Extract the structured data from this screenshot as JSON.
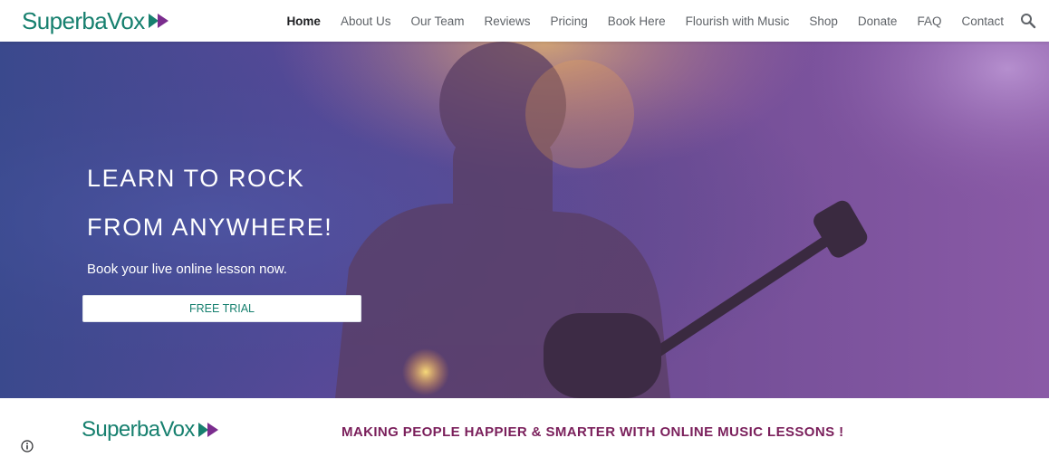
{
  "brand": {
    "name": "SuperbaVox",
    "primary_color": "#17806f",
    "accent_color": "#7b2d8e"
  },
  "nav": {
    "items": [
      {
        "label": "Home",
        "active": true
      },
      {
        "label": "About Us"
      },
      {
        "label": "Our Team"
      },
      {
        "label": "Reviews"
      },
      {
        "label": "Pricing"
      },
      {
        "label": "Book Here"
      },
      {
        "label": "Flourish with Music"
      },
      {
        "label": "Shop"
      },
      {
        "label": "Donate"
      },
      {
        "label": "FAQ"
      },
      {
        "label": "Contact"
      }
    ],
    "search_icon": "search-icon"
  },
  "hero": {
    "title_line1": "LEARN TO ROCK",
    "title_line2": "FROM ANYWHERE!",
    "subtitle": "Book your live online lesson now.",
    "cta_label": "FREE TRIAL"
  },
  "section": {
    "logo_text": "SuperbaVox",
    "tagline": "MAKING PEOPLE HAPPIER & SMARTER WITH ONLINE MUSIC LESSONS !",
    "tagline_color": "#7a1f5b"
  },
  "footer": {
    "info_icon": "info-icon"
  }
}
